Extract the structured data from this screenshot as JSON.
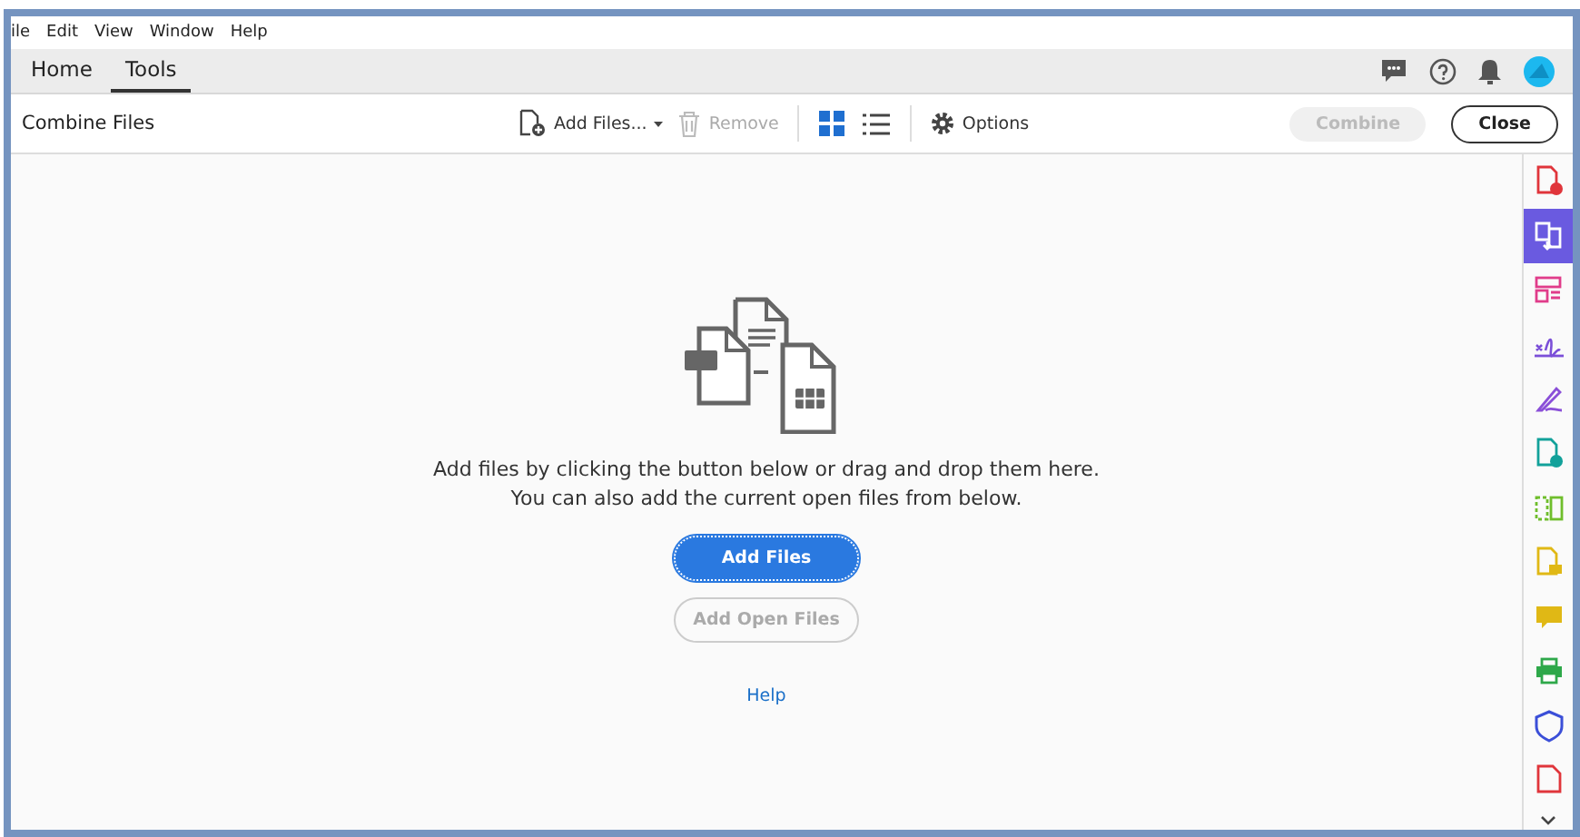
{
  "menu": [
    {
      "label": "ile"
    },
    {
      "label": "Edit"
    },
    {
      "label": "View"
    },
    {
      "label": "Window"
    },
    {
      "label": "Help"
    }
  ],
  "tabs": [
    {
      "label": "Home",
      "selected": false
    },
    {
      "label": "Tools",
      "selected": true
    }
  ],
  "toolbar": {
    "title": "Combine Files",
    "add_files": {
      "label": "Add Files..."
    },
    "remove": {
      "label": "Remove",
      "disabled": true
    },
    "views": [
      {
        "kind": "grid",
        "selected": true
      },
      {
        "kind": "list",
        "selected": false
      }
    ],
    "options": {
      "label": "Options"
    },
    "combine": {
      "label": "Combine",
      "disabled": true
    },
    "close": {
      "label": "Close"
    }
  },
  "main": {
    "lines": [
      "Add files by clicking the button below or drag and drop them here.",
      "You can also add the current open files from below."
    ],
    "add_files": {
      "label": "Add Files"
    },
    "add_open_files": {
      "label": "Add Open Files",
      "disabled": true
    },
    "help": "Help"
  },
  "tools": [
    {
      "kind": "pdf-add",
      "color": "#e0353b",
      "selected": false
    },
    {
      "kind": "combine",
      "color": "#ffffff",
      "selected": true
    },
    {
      "kind": "organize",
      "color": "#e03c8a",
      "selected": false
    },
    {
      "kind": "sign",
      "color": "#7b4fd8",
      "selected": false
    },
    {
      "kind": "pen",
      "color": "#8a4fd8",
      "selected": false
    },
    {
      "kind": "pdf-add",
      "color": "#12a19a",
      "selected": false
    },
    {
      "kind": "compress",
      "color": "#6fbe2c",
      "selected": false
    },
    {
      "kind": "note",
      "color": "#e0b815",
      "selected": false
    },
    {
      "kind": "comment",
      "color": "#e0b815",
      "selected": false
    },
    {
      "kind": "print",
      "color": "#2ea84a",
      "selected": false
    },
    {
      "kind": "shield",
      "color": "#3b4fd8",
      "selected": false
    },
    {
      "kind": "pdf",
      "color": "#e0353b",
      "selected": false
    }
  ]
}
